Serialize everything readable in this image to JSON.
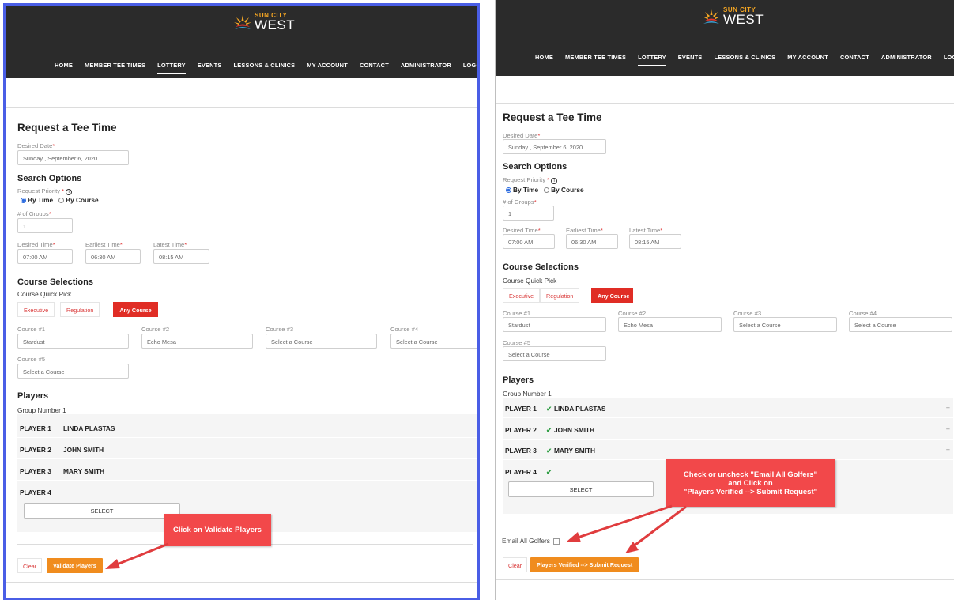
{
  "brand": {
    "line1": "SUN CITY",
    "line2": "WEST",
    "logo_icon": "sunburst-icon"
  },
  "nav": [
    "HOME",
    "MEMBER TEE TIMES",
    "LOTTERY",
    "EVENTS",
    "LESSONS & CLINICS",
    "MY ACCOUNT",
    "CONTACT",
    "ADMINISTRATOR",
    "LOGOUT"
  ],
  "nav_active": "LOTTERY",
  "form": {
    "title": "Request a Tee Time",
    "desired_date_label": "Desired Date",
    "desired_date_value": "Sunday , September 6, 2020",
    "search_options_heading": "Search Options",
    "request_priority_label": "Request Priority",
    "radio_by_time": "By Time",
    "radio_by_course": "By Course",
    "groups_label": "# of Groups",
    "groups_value": "1",
    "desired_time_label": "Desired Time",
    "desired_time_value": "07:00 AM",
    "earliest_time_label": "Earliest Time",
    "earliest_time_value": "06:30 AM",
    "latest_time_label": "Latest Time",
    "latest_time_value": "08:15 AM",
    "required_mark": "*",
    "info_symbol": "i",
    "course_selections_heading": "Course Selections",
    "quick_pick_label": "Course Quick Pick",
    "quick_executive": "Executive",
    "quick_regulation": "Regulation",
    "quick_any": "Any Course",
    "course1_label": "Course #1",
    "course1_value": "Stardust",
    "course2_label": "Course #2",
    "course2_value": "Echo Mesa",
    "course3_label": "Course #3",
    "course3_value": "Select a Course",
    "course4_label": "Course #4",
    "course4_value": "Select a Course",
    "course5_label": "Course #5",
    "course5_value": "Select a Course",
    "players_heading": "Players",
    "group_label": "Group Number 1",
    "players": [
      {
        "label": "PLAYER 1",
        "name": "LINDA PLASTAS"
      },
      {
        "label": "PLAYER 2",
        "name": "JOHN SMITH"
      },
      {
        "label": "PLAYER 3",
        "name": "MARY SMITH"
      },
      {
        "label": "PLAYER 4",
        "name": ""
      }
    ],
    "check_mark": "✔",
    "plus_sign": "+",
    "select_button": "SELECT",
    "clear_button": "Clear",
    "validate_button": "Validate Players",
    "email_all_label": "Email All Golfers",
    "submit_button": "Players Verified --> Submit Request"
  },
  "annotations": {
    "left_callout": "Click on Validate Players",
    "right_callout_line1": "Check or uncheck \"Email All Golfers\"",
    "right_callout_line2": "and Click on",
    "right_callout_line3": "\"Players Verified --> Submit Request\"",
    "callout_color": "#f2484a"
  },
  "colors": {
    "topbar": "#2b2b2b",
    "accent_red": "#e02d25",
    "accent_orange": "#f08c1e",
    "frame_blue": "#4a5ee6",
    "check_green": "#2f9e44"
  }
}
